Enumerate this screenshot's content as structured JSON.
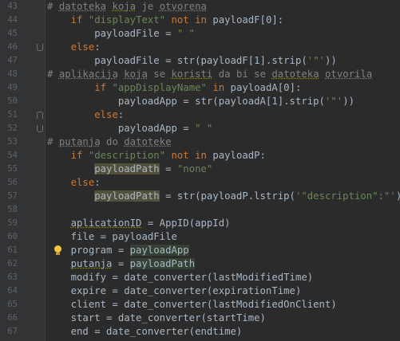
{
  "lines": [
    {
      "num": "43",
      "parts": [
        {
          "t": "# ",
          "c": "cmt"
        },
        {
          "t": "datoteka",
          "c": "cmt squig"
        },
        {
          "t": " ",
          "c": "cmt"
        },
        {
          "t": "koja",
          "c": "cmt squig"
        },
        {
          "t": " je ",
          "c": "cmt"
        },
        {
          "t": "otvorena",
          "c": "cmt squig"
        }
      ]
    },
    {
      "num": "44",
      "parts": [
        {
          "t": "    "
        },
        {
          "t": "if ",
          "c": "kw"
        },
        {
          "t": "\"displayText\"",
          "c": "str"
        },
        {
          "t": " "
        },
        {
          "t": "not in",
          "c": "kw"
        },
        {
          "t": " payloadF[0]:"
        }
      ]
    },
    {
      "num": "45",
      "parts": [
        {
          "t": "        payloadFile = "
        },
        {
          "t": "\" \"",
          "c": "str"
        }
      ]
    },
    {
      "num": "46",
      "parts": [
        {
          "t": "    "
        },
        {
          "t": "else",
          "c": "kw"
        },
        {
          "t": ":"
        }
      ]
    },
    {
      "num": "47",
      "parts": [
        {
          "t": "        payloadFile = str(payloadF[1].strip("
        },
        {
          "t": "'\"'",
          "c": "str"
        },
        {
          "t": "))"
        }
      ]
    },
    {
      "num": "48",
      "parts": [
        {
          "t": "# ",
          "c": "cmt"
        },
        {
          "t": "aplikacija",
          "c": "cmt squig"
        },
        {
          "t": " ",
          "c": "cmt"
        },
        {
          "t": "koja",
          "c": "cmt squig"
        },
        {
          "t": " se ",
          "c": "cmt"
        },
        {
          "t": "koristi",
          "c": "cmt squig"
        },
        {
          "t": " da bi se ",
          "c": "cmt"
        },
        {
          "t": "datoteka",
          "c": "cmt squig"
        },
        {
          "t": " ",
          "c": "cmt"
        },
        {
          "t": "otvorila",
          "c": "cmt squig"
        }
      ]
    },
    {
      "num": "49",
      "parts": [
        {
          "t": "        "
        },
        {
          "t": "if ",
          "c": "kw"
        },
        {
          "t": "\"appDisplayName\"",
          "c": "str"
        },
        {
          "t": " "
        },
        {
          "t": "in",
          "c": "kw"
        },
        {
          "t": " payloadA[0]:"
        }
      ]
    },
    {
      "num": "50",
      "parts": [
        {
          "t": "            payloadApp = str(payloadA[1].strip("
        },
        {
          "t": "'\"'",
          "c": "str"
        },
        {
          "t": "))"
        }
      ]
    },
    {
      "num": "51",
      "parts": [
        {
          "t": "        "
        },
        {
          "t": "else",
          "c": "kw"
        },
        {
          "t": ":"
        }
      ]
    },
    {
      "num": "52",
      "parts": [
        {
          "t": "            payloadApp = "
        },
        {
          "t": "\" \"",
          "c": "str"
        }
      ]
    },
    {
      "num": "53",
      "parts": [
        {
          "t": "# ",
          "c": "cmt"
        },
        {
          "t": "putanja",
          "c": "cmt squig"
        },
        {
          "t": " do ",
          "c": "cmt"
        },
        {
          "t": "datoteke",
          "c": "cmt squig"
        }
      ]
    },
    {
      "num": "54",
      "parts": [
        {
          "t": "    "
        },
        {
          "t": "if ",
          "c": "kw"
        },
        {
          "t": "\"description\"",
          "c": "str"
        },
        {
          "t": " "
        },
        {
          "t": "not in",
          "c": "kw"
        },
        {
          "t": " payloadP:"
        }
      ]
    },
    {
      "num": "55",
      "parts": [
        {
          "t": "        "
        },
        {
          "t": "payloadPath",
          "c": "err"
        },
        {
          "t": " = "
        },
        {
          "t": "\"none\"",
          "c": "str"
        }
      ]
    },
    {
      "num": "56",
      "parts": [
        {
          "t": "    "
        },
        {
          "t": "else",
          "c": "kw"
        },
        {
          "t": ":"
        }
      ]
    },
    {
      "num": "57",
      "parts": [
        {
          "t": "        "
        },
        {
          "t": "payloadPath",
          "c": "err"
        },
        {
          "t": " = str(payloadP.lstrip("
        },
        {
          "t": "'\"description\":\"'",
          "c": "str"
        },
        {
          "t": "))"
        }
      ]
    },
    {
      "num": "58",
      "parts": []
    },
    {
      "num": "59",
      "parts": [
        {
          "t": "    "
        },
        {
          "t": "aplicationID",
          "c": "squig"
        },
        {
          "t": " = AppID(appId)"
        }
      ]
    },
    {
      "num": "60",
      "parts": [
        {
          "t": "    file = payloadFile"
        }
      ]
    },
    {
      "num": "61",
      "parts": [
        {
          "t": "    program = "
        },
        {
          "t": "payloadApp",
          "c": "usage"
        }
      ]
    },
    {
      "num": "62",
      "parts": [
        {
          "t": "    "
        },
        {
          "t": "putanja",
          "c": "squig"
        },
        {
          "t": " = "
        },
        {
          "t": "payloadPath",
          "c": "usage"
        }
      ]
    },
    {
      "num": "63",
      "parts": [
        {
          "t": "    modify = date_converter(lastModifiedTime)"
        }
      ]
    },
    {
      "num": "64",
      "parts": [
        {
          "t": "    expire = date_converter(expirationTime)"
        }
      ]
    },
    {
      "num": "65",
      "parts": [
        {
          "t": "    client = date_converter(lastModifiedOnClient)"
        }
      ]
    },
    {
      "num": "66",
      "parts": [
        {
          "t": "    start = date_converter(startTime)"
        }
      ]
    },
    {
      "num": "67",
      "parts": [
        {
          "t": "    end = date_converter(endtime)"
        }
      ]
    }
  ],
  "fold_markers": [
    {
      "line": "46",
      "icon": "fold-end-icon"
    },
    {
      "line": "51",
      "icon": "fold-start-icon"
    },
    {
      "line": "52",
      "icon": "fold-end-icon"
    }
  ],
  "intention_bulb": {
    "line": "61",
    "icon": "lightbulb-icon"
  }
}
